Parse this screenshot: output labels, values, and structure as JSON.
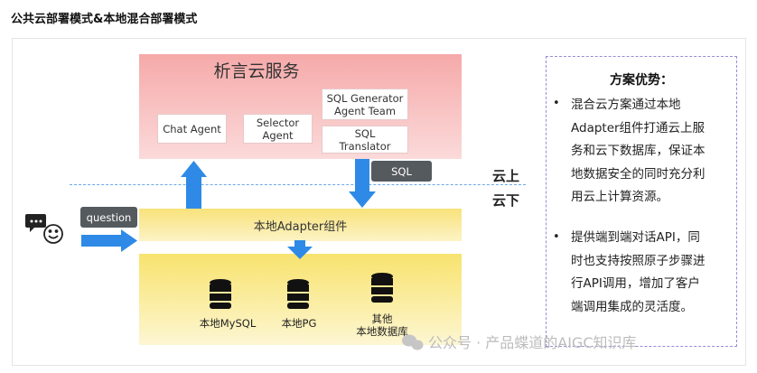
{
  "page": {
    "title": "公共云部署模式&本地混合部署模式"
  },
  "cloud_service": {
    "title": "析言云服务",
    "agents": {
      "chat": "Chat Agent",
      "selector_line1": "Selector",
      "selector_line2": "Agent",
      "sqlgen_line1": "SQL Generator",
      "sqlgen_line2": "Agent Team",
      "translator_line1": "SQL",
      "translator_line2": "Translator"
    }
  },
  "tags": {
    "sql": "SQL",
    "question": "question"
  },
  "boundary": {
    "upper": "云上",
    "lower": "云下"
  },
  "adapter": {
    "label": "本地Adapter组件"
  },
  "databases": {
    "mysql": "本地MySQL",
    "pg": "本地PG",
    "other_line1": "其他",
    "other_line2": "本地数据库"
  },
  "advantages": {
    "title": "方案优势：",
    "items": [
      [
        "混合云方案通过本地",
        "Adapter组件打通云上服",
        "务和云下数据库，保证本",
        "地数据安全的同时充分利",
        "用云上计算资源。"
      ],
      [
        "提供端到端对话API，同",
        "时也支持按照原子步骤进",
        "行API调用，增加了客户",
        "端调用集成的灵活度。"
      ]
    ]
  },
  "watermark": "公众号 · 产品蝶道的AIGC知识库",
  "colors": {
    "arrow": "#2e8ae6",
    "cloud_top": "#f6a9a9",
    "adapter_top": "#f8e27a",
    "tag_bg": "#555a5f",
    "divider": "#6aa9e9"
  },
  "icons": [
    "chat-bubble-icon",
    "smiley-icon",
    "database-icon",
    "wechat-icon"
  ]
}
